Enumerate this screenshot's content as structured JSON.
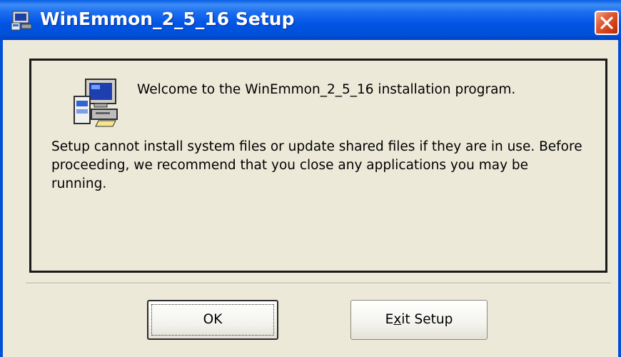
{
  "window": {
    "title": "WinEmmon_2_5_16 Setup",
    "icons": {
      "app": "installer-computer-icon",
      "close": "close-icon"
    }
  },
  "panel": {
    "welcome": "Welcome to the WinEmmon_2_5_16 installation program.",
    "message": "Setup cannot install system files or update shared files if they are in use. Before proceeding, we recommend that you close any applications you may be running.",
    "icon": "setup-computer-icon"
  },
  "buttons": {
    "ok_label": "OK",
    "exit_label_prefix": "E",
    "exit_label_accel": "x",
    "exit_label_suffix": "it Setup"
  },
  "colors": {
    "titlebar": "#0054e3",
    "close": "#d33f16",
    "dialog_bg": "#ece9d8"
  }
}
